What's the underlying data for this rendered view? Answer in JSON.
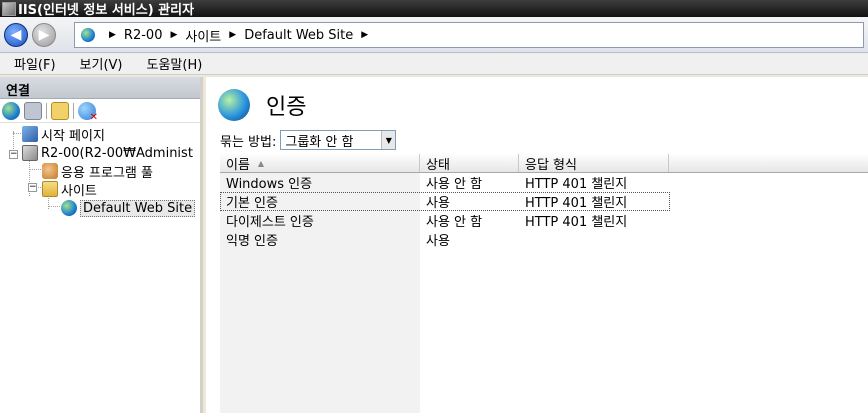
{
  "window": {
    "title": "IIS(인터넷 정보 서비스) 관리자"
  },
  "address": {
    "segments": [
      "R2-00",
      "사이트",
      "Default Web Site"
    ]
  },
  "menu": {
    "items": [
      "파일(F)",
      "보기(V)",
      "도움말(H)"
    ]
  },
  "connections": {
    "header": "연결",
    "tree": {
      "start_page": "시작 페이지",
      "server": "R2-00(R2-00₩Administ",
      "app_pools": "응용 프로그램 풀",
      "sites": "사이트",
      "default_site": "Default Web Site"
    }
  },
  "main": {
    "title": "인증",
    "group_by_label": "묶는 방법:",
    "group_by_value": "그룹화 안 함",
    "columns": [
      "이름",
      "상태",
      "응답 형식"
    ],
    "rows": [
      {
        "name": "Windows 인증",
        "status": "사용 안 함",
        "response": "HTTP 401 챌린지"
      },
      {
        "name": "기본 인증",
        "status": "사용",
        "response": "HTTP 401 챌린지"
      },
      {
        "name": "다이제스트 인증",
        "status": "사용 안 함",
        "response": "HTTP 401 챌린지"
      },
      {
        "name": "익명 인증",
        "status": "사용",
        "response": ""
      }
    ]
  }
}
